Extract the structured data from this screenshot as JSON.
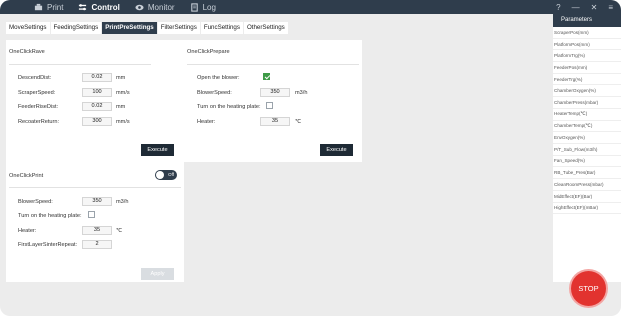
{
  "topnav": {
    "items": [
      {
        "label": "Print",
        "icon": "print-icon",
        "active": false
      },
      {
        "label": "Control",
        "icon": "control-icon",
        "active": true
      },
      {
        "label": "Monitor",
        "icon": "monitor-icon",
        "active": false
      },
      {
        "label": "Log",
        "icon": "log-icon",
        "active": false
      }
    ]
  },
  "window_controls": {
    "help": "?",
    "minimize": "—",
    "close": "✕",
    "menu": "≡"
  },
  "tabs": [
    {
      "label": "MoveSettings",
      "active": false
    },
    {
      "label": "FeedingSettings",
      "active": false
    },
    {
      "label": "PrintPreSettings",
      "active": true
    },
    {
      "label": "FilterSettings",
      "active": false
    },
    {
      "label": "FuncSettings",
      "active": false
    },
    {
      "label": "OtherSettings",
      "active": false
    }
  ],
  "one_click_rave": {
    "title": "OneClickRave",
    "rows": [
      {
        "label": "DescendDist:",
        "value": "0.02",
        "unit": "mm"
      },
      {
        "label": "ScraperSpeed:",
        "value": "100",
        "unit": "mm/s"
      },
      {
        "label": "FeederRiseDist:",
        "value": "0.02",
        "unit": "mm"
      },
      {
        "label": "RecoaterReturn:",
        "value": "300",
        "unit": "mm/s"
      }
    ],
    "execute_label": "Execute"
  },
  "one_click_prepare": {
    "title": "OneClickPrepare",
    "open_blower_label": "Open the blower:",
    "open_blower_checked": true,
    "blower_speed_label": "BlowerSpeed:",
    "blower_speed_value": "350",
    "blower_speed_unit": "m3/h",
    "heating_plate_label": "Turn on the heating plate:",
    "heating_plate_checked": false,
    "heater_label": "Heater:",
    "heater_value": "35",
    "heater_unit": "℃",
    "execute_label": "Execute"
  },
  "one_click_print": {
    "title": "OneClickPrint",
    "toggle_label": "Off",
    "blower_speed_label": "BlowerSpeed:",
    "blower_speed_value": "350",
    "blower_speed_unit": "m3/h",
    "heating_plate_label": "Turn on the heating plate:",
    "heating_plate_checked": false,
    "heater_label": "Heater:",
    "heater_value": "35",
    "heater_unit": "℃",
    "first_layer_label": "FirstLayerSinterRepeat:",
    "first_layer_value": "2",
    "apply_label": "Apply"
  },
  "parameters": {
    "title": "Parameters",
    "items": [
      "ScraperPos(mm)",
      "PlatformPos(mm)",
      "PlatformTrg(%)",
      "FeederPos(mm)",
      "FeederTrg(%)",
      "ChamberOxygen(%)",
      "ChamberPress(mbar)",
      "HeaterTemp(℃)",
      "ChamberTemp(℃)",
      "EnvOxygen(%)",
      "P/T_Sub_Flow(m3/h)",
      "Fan_Speed(%)",
      "RB_Tube_Pres(Bar)",
      "CleanRoomPress(mbar)",
      "MidEffect(EF)(Bar)",
      "HighEffect(EF)(mBar)"
    ]
  },
  "stop_label": "STOP",
  "colors": {
    "accent": "#2f3d4c",
    "stop": "#e2332f",
    "checked": "#3e9b47"
  }
}
